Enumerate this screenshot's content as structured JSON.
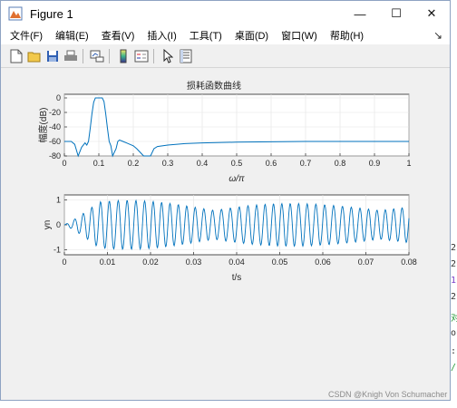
{
  "window": {
    "title": "Figure 1",
    "controls": {
      "minimize": "—",
      "maximize": "☐",
      "close": "✕"
    }
  },
  "menu": [
    "文件(F)",
    "编辑(E)",
    "查看(V)",
    "插入(I)",
    "工具(T)",
    "桌面(D)",
    "窗口(W)",
    "帮助(H)"
  ],
  "menu_overflow": "↘",
  "toolbar": [
    "new-figure-icon",
    "open-file-icon",
    "save-icon",
    "print-icon",
    "link-plot-icon",
    "insert-colorbar-icon",
    "insert-legend-icon",
    "edit-plot-icon",
    "property-inspector-icon"
  ],
  "right_strip_chars": [
    "2",
    "2",
    "1",
    "2",
    "对",
    "o",
    ":",
    "/"
  ],
  "watermark": "CSDN @Knigh Von Schumacher",
  "colors": {
    "line": "#0072BD",
    "axes_bg": "#ffffff",
    "grid": "#e3e3e3",
    "figure_bg": "#f0f0f0"
  },
  "chart_data": [
    {
      "type": "line",
      "title": "损耗函数曲线",
      "xlabel": "ω/π",
      "ylabel": "幅度(dB)",
      "xlim": [
        0,
        1
      ],
      "ylim": [
        -80,
        5
      ],
      "xticks": [
        "0",
        "0.1",
        "0.2",
        "0.3",
        "0.4",
        "0.5",
        "0.6",
        "0.7",
        "0.8",
        "0.9",
        "1"
      ],
      "yticks": [
        "0",
        "-20",
        "-40",
        "-60",
        "-80"
      ],
      "grid": true,
      "series": [
        {
          "x": [
            0,
            0.02,
            0.03,
            0.04,
            0.05,
            0.06,
            0.065,
            0.07,
            0.075,
            0.08,
            0.085,
            0.09,
            0.095,
            0.1,
            0.105,
            0.11,
            0.115,
            0.12,
            0.125,
            0.13,
            0.135,
            0.14,
            0.15,
            0.155,
            0.16,
            0.17,
            0.18,
            0.19,
            0.2,
            0.21,
            0.22,
            0.23,
            0.24,
            0.25,
            0.26,
            0.27,
            0.3,
            0.35,
            0.4,
            0.5,
            0.6,
            0.7,
            0.8,
            0.9,
            1
          ],
          "y": [
            -60,
            -60,
            -64,
            -80,
            -68,
            -62,
            -65,
            -60,
            -42,
            -22,
            -6,
            0,
            0,
            0,
            0,
            0,
            -5,
            -22,
            -42,
            -60,
            -66,
            -80,
            -70,
            -60,
            -58,
            -60,
            -62,
            -64,
            -66,
            -70,
            -75,
            -80,
            -80,
            -80,
            -70,
            -67,
            -65,
            -63,
            -62,
            -61,
            -60.5,
            -60,
            -60,
            -60,
            -60
          ]
        }
      ]
    },
    {
      "type": "line",
      "title": "",
      "xlabel": "t/s",
      "ylabel": "yn",
      "xlim": [
        0,
        0.08
      ],
      "ylim": [
        -1.2,
        1.2
      ],
      "xticks": [
        "0",
        "0.01",
        "0.02",
        "0.03",
        "0.04",
        "0.05",
        "0.06",
        "0.07",
        "0.08"
      ],
      "yticks": [
        "1",
        "0",
        "-1"
      ],
      "grid": true,
      "series": [
        {
          "signal": "bandpass output: carrier 500 Hz, amplitude modulated (beats)",
          "carrier_hz": 500,
          "samples": 641,
          "x_start": 0,
          "x_end": 0.08
        }
      ]
    }
  ]
}
